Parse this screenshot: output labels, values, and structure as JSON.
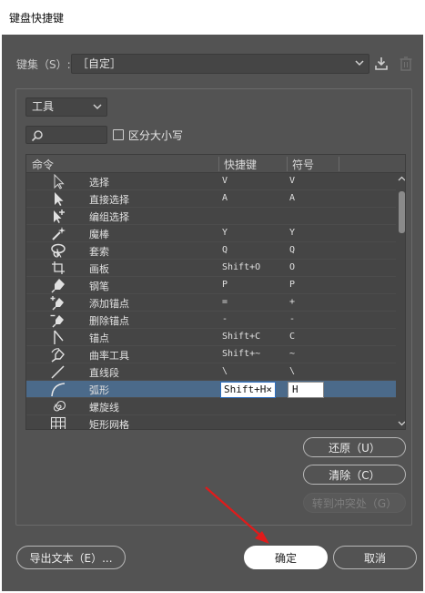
{
  "window": {
    "title": "键盘快捷键"
  },
  "set": {
    "label": "键集（S）:",
    "value": "［自定］"
  },
  "type_selector": {
    "value": "工具"
  },
  "search": {
    "placeholder": "",
    "value": ""
  },
  "case_checkbox": {
    "label": "区分大小写",
    "checked": false
  },
  "table": {
    "headers": {
      "command": "命令",
      "shortcut": "快捷键",
      "symbol": "符号"
    },
    "rows": [
      {
        "icon": "selection-tool-icon",
        "name": "选择",
        "key": "V",
        "symbol": "V"
      },
      {
        "icon": "direct-selection-tool-icon",
        "name": "直接选择",
        "key": "A",
        "symbol": "A"
      },
      {
        "icon": "group-selection-tool-icon",
        "name": "编组选择",
        "key": "",
        "symbol": ""
      },
      {
        "icon": "magic-wand-tool-icon",
        "name": "魔棒",
        "key": "Y",
        "symbol": "Y"
      },
      {
        "icon": "lasso-tool-icon",
        "name": "套索",
        "key": "Q",
        "symbol": "Q"
      },
      {
        "icon": "artboard-tool-icon",
        "name": "画板",
        "key": "Shift+O",
        "symbol": "O"
      },
      {
        "icon": "pen-tool-icon",
        "name": "钢笔",
        "key": "P",
        "symbol": "P"
      },
      {
        "icon": "add-anchor-point-icon",
        "name": "添加锚点",
        "key": "=",
        "symbol": "+"
      },
      {
        "icon": "delete-anchor-point-icon",
        "name": "删除锚点",
        "key": "-",
        "symbol": "-"
      },
      {
        "icon": "anchor-point-tool-icon",
        "name": "锚点",
        "key": "Shift+C",
        "symbol": "C"
      },
      {
        "icon": "curvature-tool-icon",
        "name": "曲率工具",
        "key": "Shift+~",
        "symbol": "~"
      },
      {
        "icon": "line-segment-tool-icon",
        "name": "直线段",
        "key": "\\",
        "symbol": "\\"
      },
      {
        "icon": "arc-tool-icon",
        "name": "弧形",
        "key": "Shift+H×",
        "symbol": "H",
        "selected": true
      },
      {
        "icon": "spiral-tool-icon",
        "name": "螺旋线",
        "key": "",
        "symbol": ""
      },
      {
        "icon": "rectangular-grid-tool-icon",
        "name": "矩形网格",
        "key": "",
        "symbol": ""
      }
    ]
  },
  "buttons": {
    "restore": "还原（U）",
    "clear": "清除（C）",
    "goto_conflict": "转到冲突处（G）",
    "export_text": "导出文本（E）...",
    "ok": "确定",
    "cancel": "取消"
  },
  "colors": {
    "dialog_bg": "#535353",
    "field_bg": "#454545",
    "selection": "#4b6a8a",
    "annotation_arrow": "#e01b1b"
  }
}
